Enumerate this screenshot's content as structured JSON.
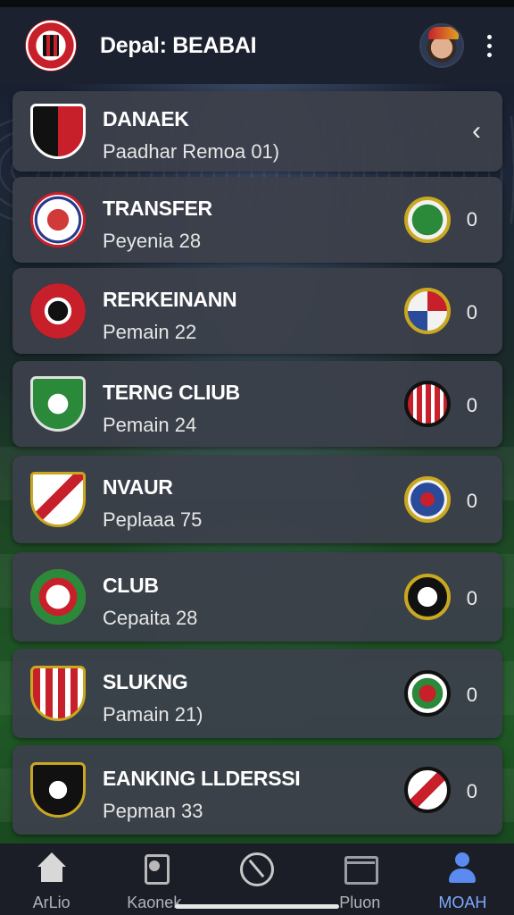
{
  "header": {
    "title": "Depal: BEABAI",
    "logo_icon": "club-crest-icon",
    "avatar_icon": "user-avatar-icon",
    "menu_icon": "kebab-menu-icon"
  },
  "featured": {
    "name": "DANAEK",
    "subtitle": "Paadhar Remoa 01)",
    "chevron": "‹"
  },
  "items": [
    {
      "name": "TRANSFER",
      "sub": "Peyenia 28",
      "count": "0"
    },
    {
      "name": "RERKEINANN",
      "sub": "Pemain 22",
      "count": "0"
    },
    {
      "name": "TERNG CLIUB",
      "sub": "Pemain 24",
      "count": "0"
    },
    {
      "name": "NVAUR",
      "sub": "Peplaaa 75",
      "count": "0"
    },
    {
      "name": "CLUB",
      "sub": "Cepaita 28",
      "count": "0"
    },
    {
      "name": "SLUKNG",
      "sub": "Pamain 21)",
      "count": "0"
    },
    {
      "name": "EANKING LLDERSSI",
      "sub": "Pepman 33",
      "count": "0"
    }
  ],
  "nav": [
    {
      "label": "ArLio",
      "icon": "home-icon"
    },
    {
      "label": "Kaonek",
      "icon": "ranking-icon"
    },
    {
      "label": "",
      "icon": "compass-icon"
    },
    {
      "label": "Pluon",
      "icon": "plan-icon"
    },
    {
      "label": "MOAH",
      "icon": "user-icon",
      "active": true
    }
  ],
  "colors": {
    "accent": "#7fa8ff",
    "card": "#3c404a",
    "header": "#1c2130"
  }
}
